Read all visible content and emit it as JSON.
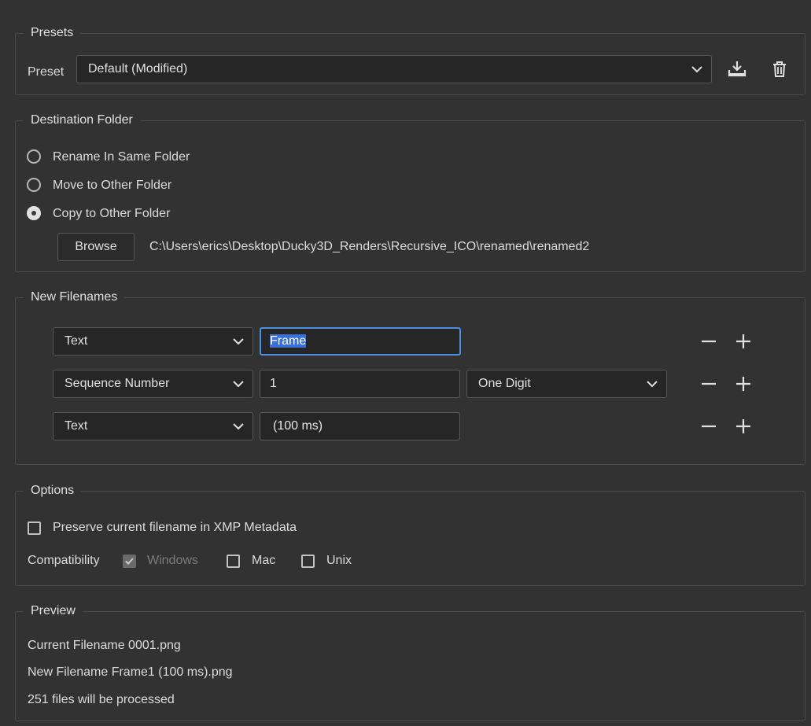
{
  "presets": {
    "legend": "Presets",
    "preset_label": "Preset",
    "preset_value": "Default (Modified)",
    "icons": [
      "save-preset-icon",
      "trash-icon",
      "chevron-down-icon"
    ]
  },
  "destination": {
    "legend": "Destination Folder",
    "options": [
      {
        "label": "Rename In Same Folder",
        "selected": false
      },
      {
        "label": "Move to Other Folder",
        "selected": false
      },
      {
        "label": "Copy to Other Folder",
        "selected": true
      }
    ],
    "browse_label": "Browse",
    "path": "C:\\Users\\erics\\Desktop\\Ducky3D_Renders\\Recursive_ICO\\renamed\\renamed2"
  },
  "filenames": {
    "legend": "New Filenames",
    "rows": [
      {
        "type": "Text",
        "value": "Frame"
      },
      {
        "type": "Sequence Number",
        "value": "1",
        "digits": "One Digit"
      },
      {
        "type": "Text",
        "value": "(100 ms)"
      }
    ],
    "icons": [
      "minus-icon",
      "plus-icon"
    ]
  },
  "options": {
    "legend": "Options",
    "preserve_label": "Preserve current filename in XMP Metadata",
    "preserve_checked": false,
    "compat_label": "Compatibility",
    "compat": [
      {
        "label": "Windows",
        "checked": true,
        "disabled": true
      },
      {
        "label": "Mac",
        "checked": false,
        "disabled": false
      },
      {
        "label": "Unix",
        "checked": false,
        "disabled": false
      }
    ]
  },
  "preview": {
    "legend": "Preview",
    "current": "Current Filename 0001.png",
    "new": "New Filename Frame1 (100 ms).png",
    "count": "251 files will be processed"
  },
  "colors": {
    "background": "#323232",
    "field": "#262626",
    "focus": "#4b8fe0",
    "selection": "#3b6fd8"
  }
}
